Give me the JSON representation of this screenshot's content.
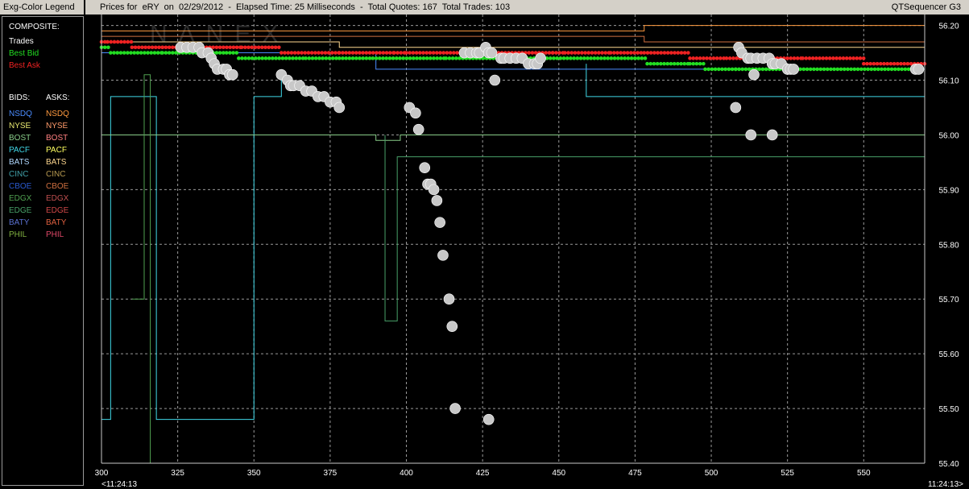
{
  "window": {
    "legend_title": "Exg-Color Legend",
    "chart_title": "Prices for  eRY  on  02/29/2012  -  Elapsed Time: 25 Milliseconds  -  Total Quotes: 167  Total Trades: 103",
    "app_name": "QTSequencer G3"
  },
  "legend": {
    "composite_title": "COMPOSITE:",
    "composite": [
      {
        "label": "Trades",
        "color": "#ffffff"
      },
      {
        "label": "Best Bid",
        "color": "#22dd22"
      },
      {
        "label": "Best Ask",
        "color": "#ee2222"
      }
    ],
    "bids_title": "BIDS:",
    "asks_title": "ASKS:",
    "exchanges": [
      {
        "bid": "NSDQ",
        "ask": "NSDQ",
        "bid_color": "#4a8cff",
        "ask_color": "#ff9a40"
      },
      {
        "bid": "NYSE",
        "ask": "NYSE",
        "bid_color": "#e8e870",
        "ask_color": "#ff9a6a"
      },
      {
        "bid": "BOST",
        "ask": "BOST",
        "bid_color": "#88cc88",
        "ask_color": "#ff8080"
      },
      {
        "bid": "PACF",
        "ask": "PACF",
        "bid_color": "#40d8e8",
        "ask_color": "#ffff60"
      },
      {
        "bid": "BATS",
        "ask": "BATS",
        "bid_color": "#b0d8ff",
        "ask_color": "#ffd890"
      },
      {
        "bid": "CINC",
        "ask": "CINC",
        "bid_color": "#40a0a8",
        "ask_color": "#b89a50"
      },
      {
        "bid": "CBOE",
        "ask": "CBOE",
        "bid_color": "#2a5ad0",
        "ask_color": "#d07040"
      },
      {
        "bid": "EDGX",
        "ask": "EDGX",
        "bid_color": "#50a050",
        "ask_color": "#c05050"
      },
      {
        "bid": "EDGE",
        "ask": "EDGE",
        "bid_color": "#48a068",
        "ask_color": "#d04848"
      },
      {
        "bid": "BATY",
        "ask": "BATY",
        "bid_color": "#5a70d0",
        "ask_color": "#e06040"
      },
      {
        "bid": "PHIL",
        "ask": "PHIL",
        "bid_color": "#80b040",
        "ask_color": "#e04868"
      }
    ]
  },
  "chart_data": {
    "type": "scatter",
    "title": "",
    "xlabel": "",
    "ylabel": "",
    "x_range": [
      300,
      570
    ],
    "y_range": [
      55.4,
      56.22
    ],
    "grid": true,
    "x_ticks": [
      "300",
      "325",
      "350",
      "375",
      "400",
      "425",
      "450",
      "475",
      "500",
      "525",
      "550"
    ],
    "y_ticks": [
      "56.20",
      "56.10",
      "56.00",
      "55.90",
      "55.80",
      "55.70",
      "55.60",
      "55.50",
      "55.40"
    ],
    "x_start_label": "<11:24:13",
    "x_end_label": "11:24:13>",
    "watermark": "NANEX",
    "colors": {
      "trade": "#c8c8c8",
      "best_bid": "#22dd22",
      "best_ask": "#ee2222",
      "grid": "#9a9a9a"
    },
    "series": [
      {
        "name": "Trades",
        "points": [
          [
            326,
            56.16
          ],
          [
            328,
            56.16
          ],
          [
            330,
            56.16
          ],
          [
            332,
            56.16
          ],
          [
            333,
            56.15
          ],
          [
            335,
            56.15
          ],
          [
            336,
            56.14
          ],
          [
            337,
            56.13
          ],
          [
            338,
            56.12
          ],
          [
            340,
            56.12
          ],
          [
            341,
            56.12
          ],
          [
            342,
            56.11
          ],
          [
            343,
            56.11
          ],
          [
            359,
            56.11
          ],
          [
            361,
            56.1
          ],
          [
            362,
            56.09
          ],
          [
            363,
            56.09
          ],
          [
            365,
            56.09
          ],
          [
            367,
            56.08
          ],
          [
            369,
            56.08
          ],
          [
            371,
            56.07
          ],
          [
            373,
            56.07
          ],
          [
            375,
            56.06
          ],
          [
            377,
            56.06
          ],
          [
            378,
            56.05
          ],
          [
            401,
            56.05
          ],
          [
            403,
            56.04
          ],
          [
            404,
            56.01
          ],
          [
            406,
            55.94
          ],
          [
            407,
            55.91
          ],
          [
            408,
            55.91
          ],
          [
            409,
            55.9
          ],
          [
            410,
            55.88
          ],
          [
            411,
            55.84
          ],
          [
            412,
            55.78
          ],
          [
            414,
            55.7
          ],
          [
            415,
            55.65
          ],
          [
            416,
            55.5
          ],
          [
            419,
            56.15
          ],
          [
            421,
            56.15
          ],
          [
            423,
            56.15
          ],
          [
            424,
            56.15
          ],
          [
            426,
            56.16
          ],
          [
            427,
            56.15
          ],
          [
            428,
            56.15
          ],
          [
            429,
            56.1
          ],
          [
            431,
            56.14
          ],
          [
            432,
            56.14
          ],
          [
            434,
            56.14
          ],
          [
            436,
            56.14
          ],
          [
            438,
            56.14
          ],
          [
            440,
            56.13
          ],
          [
            442,
            56.13
          ],
          [
            443,
            56.13
          ],
          [
            444,
            56.14
          ],
          [
            427,
            55.48
          ],
          [
            509,
            56.16
          ],
          [
            510,
            56.15
          ],
          [
            512,
            56.14
          ],
          [
            513,
            56.14
          ],
          [
            514,
            56.11
          ],
          [
            515,
            56.14
          ],
          [
            517,
            56.14
          ],
          [
            519,
            56.14
          ],
          [
            520,
            56.13
          ],
          [
            521,
            56.13
          ],
          [
            523,
            56.13
          ],
          [
            525,
            56.12
          ],
          [
            526,
            56.12
          ],
          [
            527,
            56.12
          ],
          [
            508,
            56.05
          ],
          [
            513,
            56.0
          ],
          [
            520,
            56.0
          ],
          [
            567,
            56.12
          ],
          [
            568,
            56.12
          ]
        ]
      },
      {
        "name": "Best Bid",
        "steps": [
          [
            300,
            56.16
          ],
          [
            303,
            56.15
          ],
          [
            320,
            56.15
          ],
          [
            341,
            56.15
          ],
          [
            345,
            56.14
          ],
          [
            367,
            56.14
          ],
          [
            378,
            56.14
          ],
          [
            389,
            56.14
          ],
          [
            413,
            56.14
          ],
          [
            445,
            56.14
          ],
          [
            475,
            56.14
          ],
          [
            479,
            56.13
          ],
          [
            493,
            56.13
          ],
          [
            498,
            56.12
          ],
          [
            508,
            56.12
          ],
          [
            527,
            56.12
          ],
          [
            570,
            56.12
          ]
        ]
      },
      {
        "name": "Best Ask",
        "steps": [
          [
            300,
            56.17
          ],
          [
            302,
            56.17
          ],
          [
            310,
            56.16
          ],
          [
            320,
            56.16
          ],
          [
            346,
            56.16
          ],
          [
            359,
            56.15
          ],
          [
            378,
            56.15
          ],
          [
            396,
            56.15
          ],
          [
            400,
            56.15
          ],
          [
            426,
            56.15
          ],
          [
            428,
            56.15
          ],
          [
            448,
            56.15
          ],
          [
            452,
            56.15
          ],
          [
            467,
            56.15
          ],
          [
            478,
            56.15
          ],
          [
            493,
            56.14
          ],
          [
            505,
            56.14
          ],
          [
            530,
            56.14
          ],
          [
            550,
            56.13
          ],
          [
            570,
            56.13
          ]
        ]
      }
    ]
  }
}
